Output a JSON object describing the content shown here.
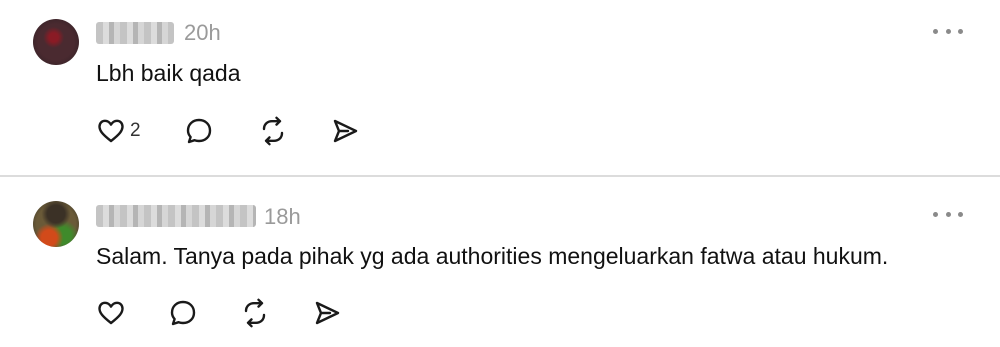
{
  "posts": [
    {
      "time": "20h",
      "text": "Lbh baik qada",
      "likes": "2"
    },
    {
      "time": "18h",
      "text": "Salam. Tanya pada pihak yg ada authorities mengeluarkan fatwa atau hukum.",
      "likes": ""
    }
  ],
  "icons": {
    "like": "heart-icon",
    "reply": "comment-bubble-icon",
    "repost": "repost-arrows-icon",
    "share": "send-icon",
    "more": "more-dots-icon"
  },
  "colors": {
    "text": "#101010",
    "muted": "#9a9a9a",
    "divider": "#dcdcdc"
  }
}
